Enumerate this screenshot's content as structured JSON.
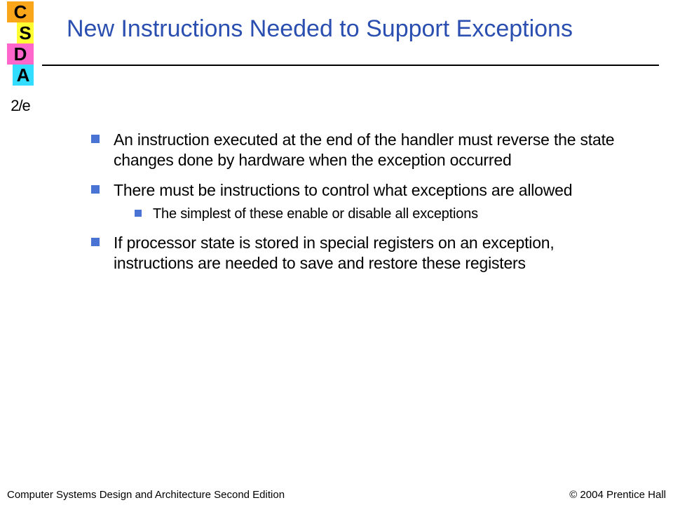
{
  "logo": {
    "c": "C",
    "s": "S",
    "d": "D",
    "a": "A",
    "edition": "2/e"
  },
  "title": "New Instructions Needed to Support Exceptions",
  "bullets": [
    {
      "text": "An instruction executed at the end of the handler must reverse the state changes done by hardware when the exception occurred"
    },
    {
      "text": "There must be instructions to control what exceptions are allowed",
      "sub": [
        {
          "text": "The simplest of these enable or disable all exceptions"
        }
      ]
    },
    {
      "text": "If processor state is stored in special registers on an exception, instructions are needed to save and restore these registers"
    }
  ],
  "footer": {
    "left": "Computer Systems Design and Architecture Second Edition",
    "right": "© 2004 Prentice Hall"
  }
}
